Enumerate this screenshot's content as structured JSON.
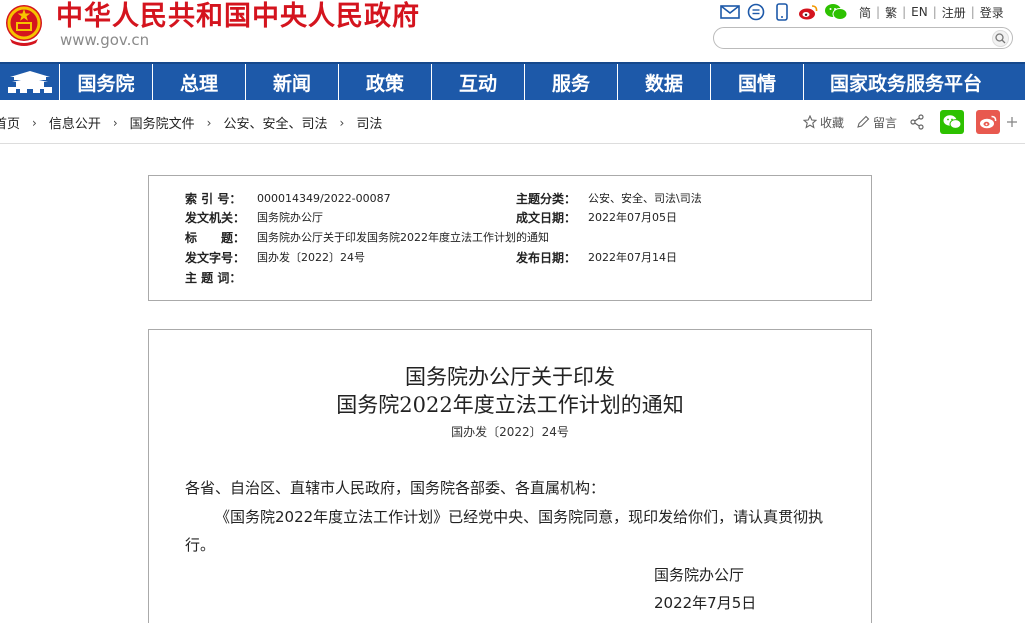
{
  "header": {
    "site_title": "中华人民共和国中央人民政府",
    "site_domain": "www.gov.cn",
    "top_links": [
      "简",
      "繁",
      "EN",
      "注册",
      "登录"
    ],
    "top_icons": [
      "mail-icon",
      "message-icon",
      "mobile-icon",
      "weibo-icon",
      "wechat-icon"
    ],
    "search_placeholder": ""
  },
  "nav": {
    "items": [
      "国务院",
      "总理",
      "新闻",
      "政策",
      "互动",
      "服务",
      "数据",
      "国情",
      "国家政务服务平台"
    ]
  },
  "breadcrumb": {
    "items": [
      "首页",
      "信息公开",
      "国务院文件",
      "公安、安全、司法",
      "司法"
    ],
    "separator": "›"
  },
  "share_tools": {
    "favorite": "收藏",
    "comment": "留言"
  },
  "info": {
    "index_label": "索 引 号：",
    "index_value": "000014349/2022-00087",
    "topic_label": "主题分类：",
    "topic_value": "公安、安全、司法\\司法",
    "issuer_label": "发文机关：",
    "issuer_value": "国务院办公厅",
    "written_label": "成文日期：",
    "written_value": "2022年07月05日",
    "title_label": "标　　题：",
    "title_value": "国务院办公厅关于印发国务院2022年度立法工作计划的通知",
    "docno_label": "发文字号：",
    "docno_value": "国办发〔2022〕24号",
    "publish_label": "发布日期：",
    "publish_value": "2022年07月14日",
    "keywords_label": "主 题 词：",
    "keywords_value": ""
  },
  "document": {
    "title_line1": "国务院办公厅关于印发",
    "title_line2": "国务院2022年度立法工作计划的通知",
    "number": "国办发〔2022〕24号",
    "addressee": "各省、自治区、直辖市人民政府，国务院各部委、各直属机构：",
    "body": "《国务院2022年度立法工作计划》已经党中央、国务院同意，现印发给你们，请认真贯彻执行。",
    "signature": "国务院办公厅",
    "date": "2022年7月5日"
  },
  "colors": {
    "brand_red": "#d4141e",
    "nav_blue": "#1d59a9",
    "wechat_green": "#2dc100",
    "weibo_red": "#e8594f"
  }
}
